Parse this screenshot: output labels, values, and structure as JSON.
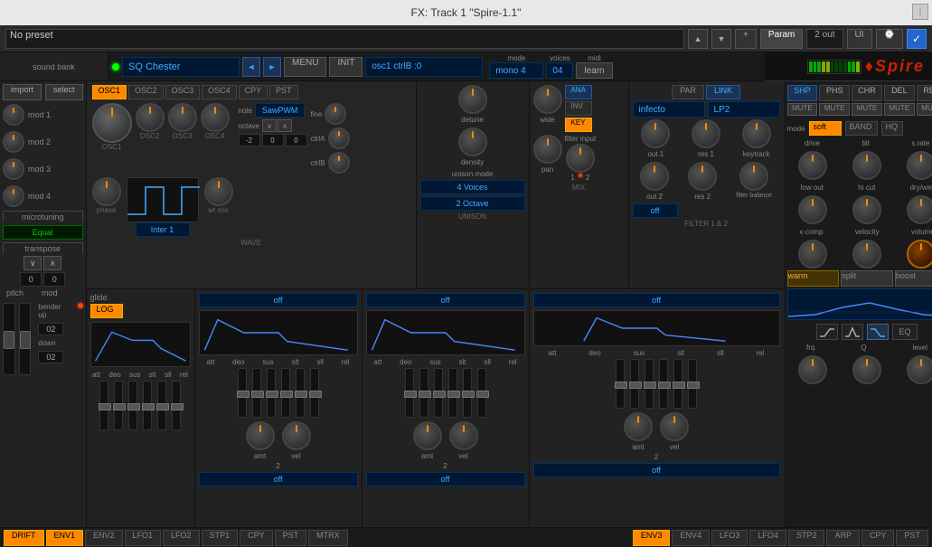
{
  "window": {
    "title": "FX: Track 1 \"Spire-1.1\""
  },
  "preset_bar": {
    "preset_name": "No preset",
    "plus_btn": "+",
    "param_btn": "Param",
    "out_value": "2 out",
    "ui_btn": "UI",
    "check": "✓"
  },
  "synth": {
    "led": "on",
    "patch_name": "SQ Chester",
    "nav_left": "◄",
    "nav_right": "►",
    "menu_btn": "MENU",
    "init_btn": "INIT",
    "osc_ctrlb": "osc1 ctrlB :0",
    "mode_label": "mode",
    "mode_value": "mono 4",
    "voices_label": "voices",
    "voices_value": "04",
    "midi_label": "midi",
    "midi_btn": "learn"
  },
  "osc_tabs": {
    "osc1": "OSC1",
    "osc2": "OSC2",
    "osc3": "OSC3",
    "osc4": "OSC4",
    "cpy": "CPY",
    "pst": "PST"
  },
  "osc_panel": {
    "note_label": "note",
    "waveform_type": "SawPWM",
    "octave_label": "octave",
    "oct_down": "∨",
    "oct_up": "∧",
    "fine_label": "fine",
    "ctrla_label": "ctrlA",
    "ctrlb_label": "ctrlB",
    "phase_label": "phase",
    "inter_label": "Inter 1",
    "wt_mix_label": "wt mix",
    "wave_label": "WAVE",
    "oct_display": "-2  0  0",
    "osc_labels": [
      "OSC1",
      "OSC2",
      "OSC3",
      "OSC4"
    ]
  },
  "unison_panel": {
    "detune_label": "detune",
    "density_label": "density",
    "mode_label": "unison mode",
    "mode_value": "4 Voices",
    "octave_value": "2 Octave",
    "label": "UNISON"
  },
  "mix_panel": {
    "wide_label": "wide",
    "ana_btn": "ANA",
    "inv_btn": "INV",
    "key_btn": "KEY",
    "pan_label": "pan",
    "filter_input_label": "filter input",
    "scale_left": "1",
    "scale_right": "2",
    "label": "MIX"
  },
  "filter_panel": {
    "par_btn": "PAR",
    "link_btn": "LINK",
    "filter_type": "infecto",
    "lp2": "LP2",
    "out1_label": "out 1",
    "res1_label": "res 1",
    "keytrack_label": "keytrack",
    "out2_label": "out 2",
    "res2_label": "res 2",
    "filter_balance_label": "filter balance",
    "off_label": "off",
    "label": "FILTER 1 & 2"
  },
  "glide_panel": {
    "title": "glide",
    "log_btn": "LOG",
    "att_label": "att",
    "dec_label": "deo",
    "sus_label": "sus",
    "slt_label": "slt",
    "sll_label": "sll",
    "rel_label": "rel"
  },
  "env1_panel": {
    "off_label": "off",
    "att": "att",
    "dec": "deo",
    "sus": "sus",
    "slt": "slt",
    "sll": "sll",
    "rel": "rel",
    "amt_label": "amt",
    "vel_label": "vel",
    "knob2_label": "2",
    "off2_label": "off"
  },
  "env3_panel": {
    "off_label": "off",
    "att": "att",
    "dec": "deo",
    "sus": "sus",
    "slt": "slt",
    "sll": "sll",
    "rel": "rel",
    "amt_label": "amt",
    "vel_label": "vel",
    "knob2_label": "2",
    "off2_label": "off"
  },
  "right_panel": {
    "logo": "♦Spire",
    "fx_btns": [
      "SHP",
      "PHS",
      "CHR",
      "DEL",
      "REV"
    ],
    "mute_btns": [
      "MUTE",
      "MUTE",
      "MUTE",
      "MUTE",
      "MUTE"
    ],
    "mode_label": "mode",
    "soft_btn": "soft",
    "band_btn": "BAND",
    "hq_btn": "HQ",
    "drive_label": "drive",
    "bit_label": "bit",
    "srate_label": "s.rate",
    "low_out_label": "low out",
    "hi_cut_label": "hi cut",
    "dry_wet_label": "dry/wet",
    "xcomp_label": "x-comp",
    "velocity_label": "velocity",
    "volume_label": "volume",
    "warm_btn": "warm",
    "split_btn": "split",
    "boost_btn": "boost",
    "eq_btn": "EQ",
    "frq_label": "frq",
    "q_label": "Q",
    "level_label": "level"
  },
  "left_panel": {
    "sound_bank_label": "sound bank",
    "import_btn": "import",
    "select_btn": "select",
    "mod1_label": "mod 1",
    "mod2_label": "mod 2",
    "mod3_label": "mod 3",
    "mod4_label": "mod 4",
    "microtuning_label": "microtuning",
    "equal_display": "Equal",
    "transpose_label": "transpose",
    "trans_down": "∨",
    "trans_up": "∧",
    "trans_val1": "0",
    "trans_val2": "0",
    "pitch_label": "pitch",
    "mod_label": "mod",
    "bender_up_label": "bender up",
    "bender_up_val": "02",
    "bender_down_label": "down",
    "bender_down_val": "02",
    "drift_btn": "DRIFT"
  },
  "bottom_tabs": {
    "left": [
      "DRIFT",
      "ENV1",
      "ENV2",
      "LFO1",
      "LFO2",
      "STP1",
      "CPY",
      "PST",
      "MTRX"
    ],
    "right": [
      "ENV3",
      "ENV4",
      "LFO3",
      "LFO4",
      "STP2",
      "ARP",
      "CPY",
      "PST"
    ]
  }
}
